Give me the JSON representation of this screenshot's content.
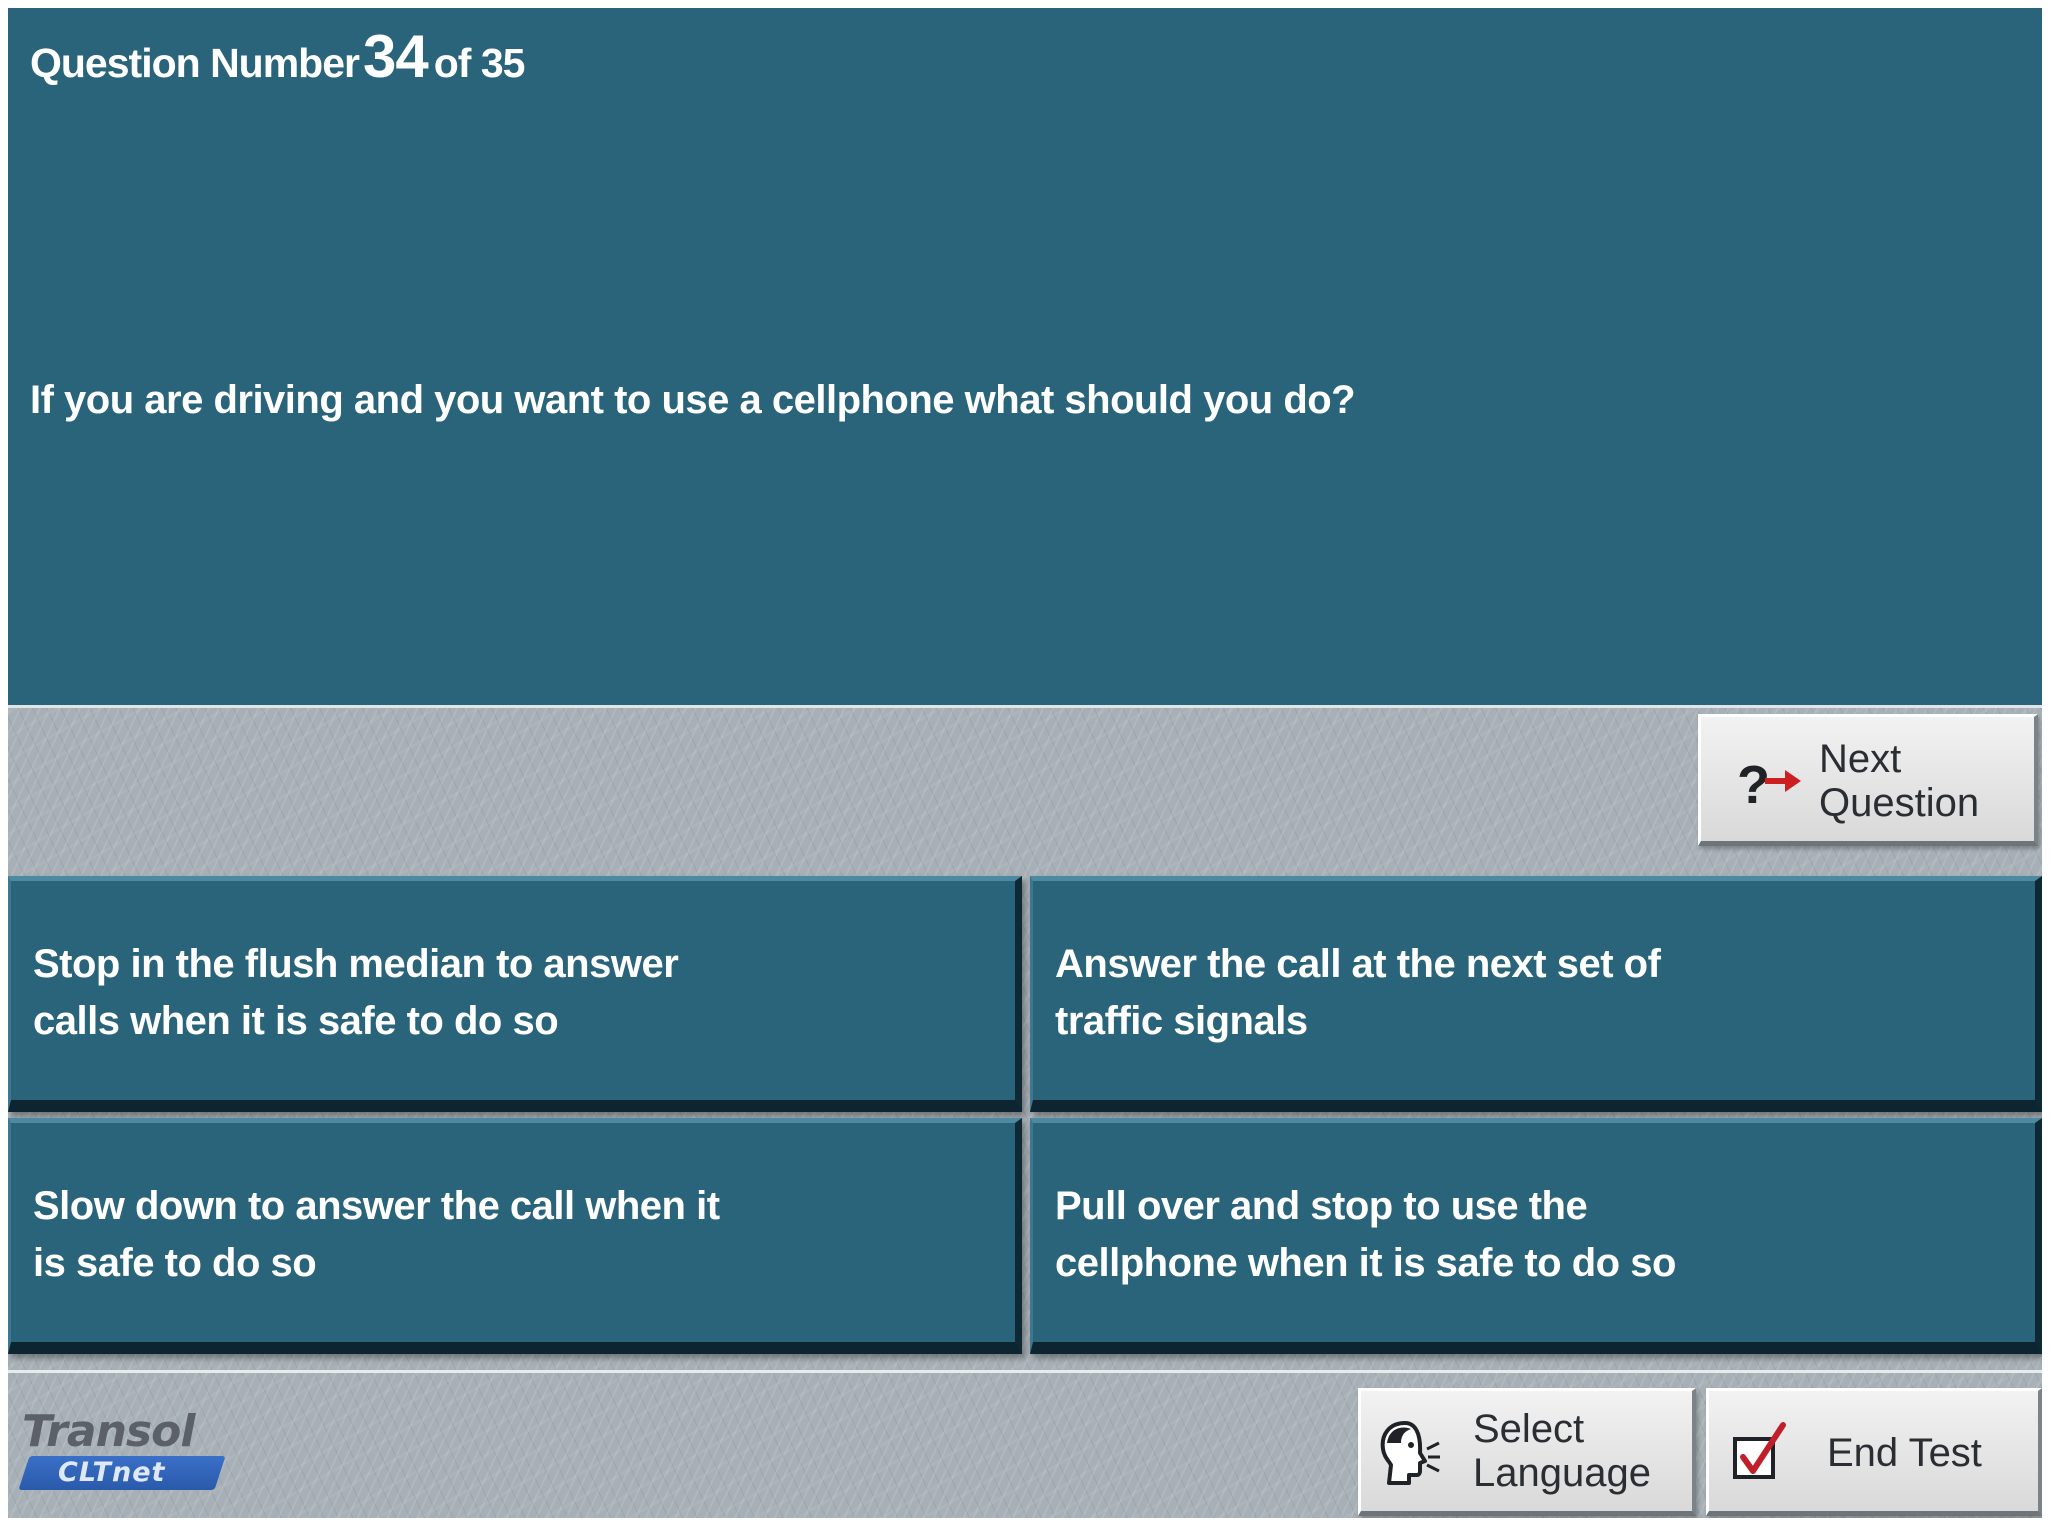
{
  "header": {
    "prefix": "Question Number",
    "current": "34",
    "of_text": "of 35"
  },
  "question": {
    "text": "If you are driving and you want to use a cellphone what should you do?"
  },
  "answers": [
    {
      "line1": "Stop in the flush median to answer",
      "line2": "calls when it is safe to do so"
    },
    {
      "line1": "Answer the call at the next set of",
      "line2": "traffic signals"
    },
    {
      "line1": "Slow down to answer the call when it",
      "line2": "is safe to do so"
    },
    {
      "line1": "Pull over and stop to use the",
      "line2": "cellphone when it is safe to do so"
    }
  ],
  "buttons": {
    "next_line1": "Next",
    "next_line2": "Question",
    "language_line1": "Select",
    "language_line2": "Language",
    "end_test": "End Test"
  },
  "logo": {
    "main": "Transol",
    "sub": "CLTnet"
  },
  "icons": {
    "next": "question-arrow-icon",
    "language": "speaking-head-icon",
    "end": "checkbox-tick-icon"
  },
  "colors": {
    "panel": "#29647a",
    "background": "#a7b0b6",
    "button_face": "#e6e6e6",
    "arrow_red": "#cc2020",
    "tick_red": "#c0202a",
    "logo_blue": "#3a70c8"
  }
}
